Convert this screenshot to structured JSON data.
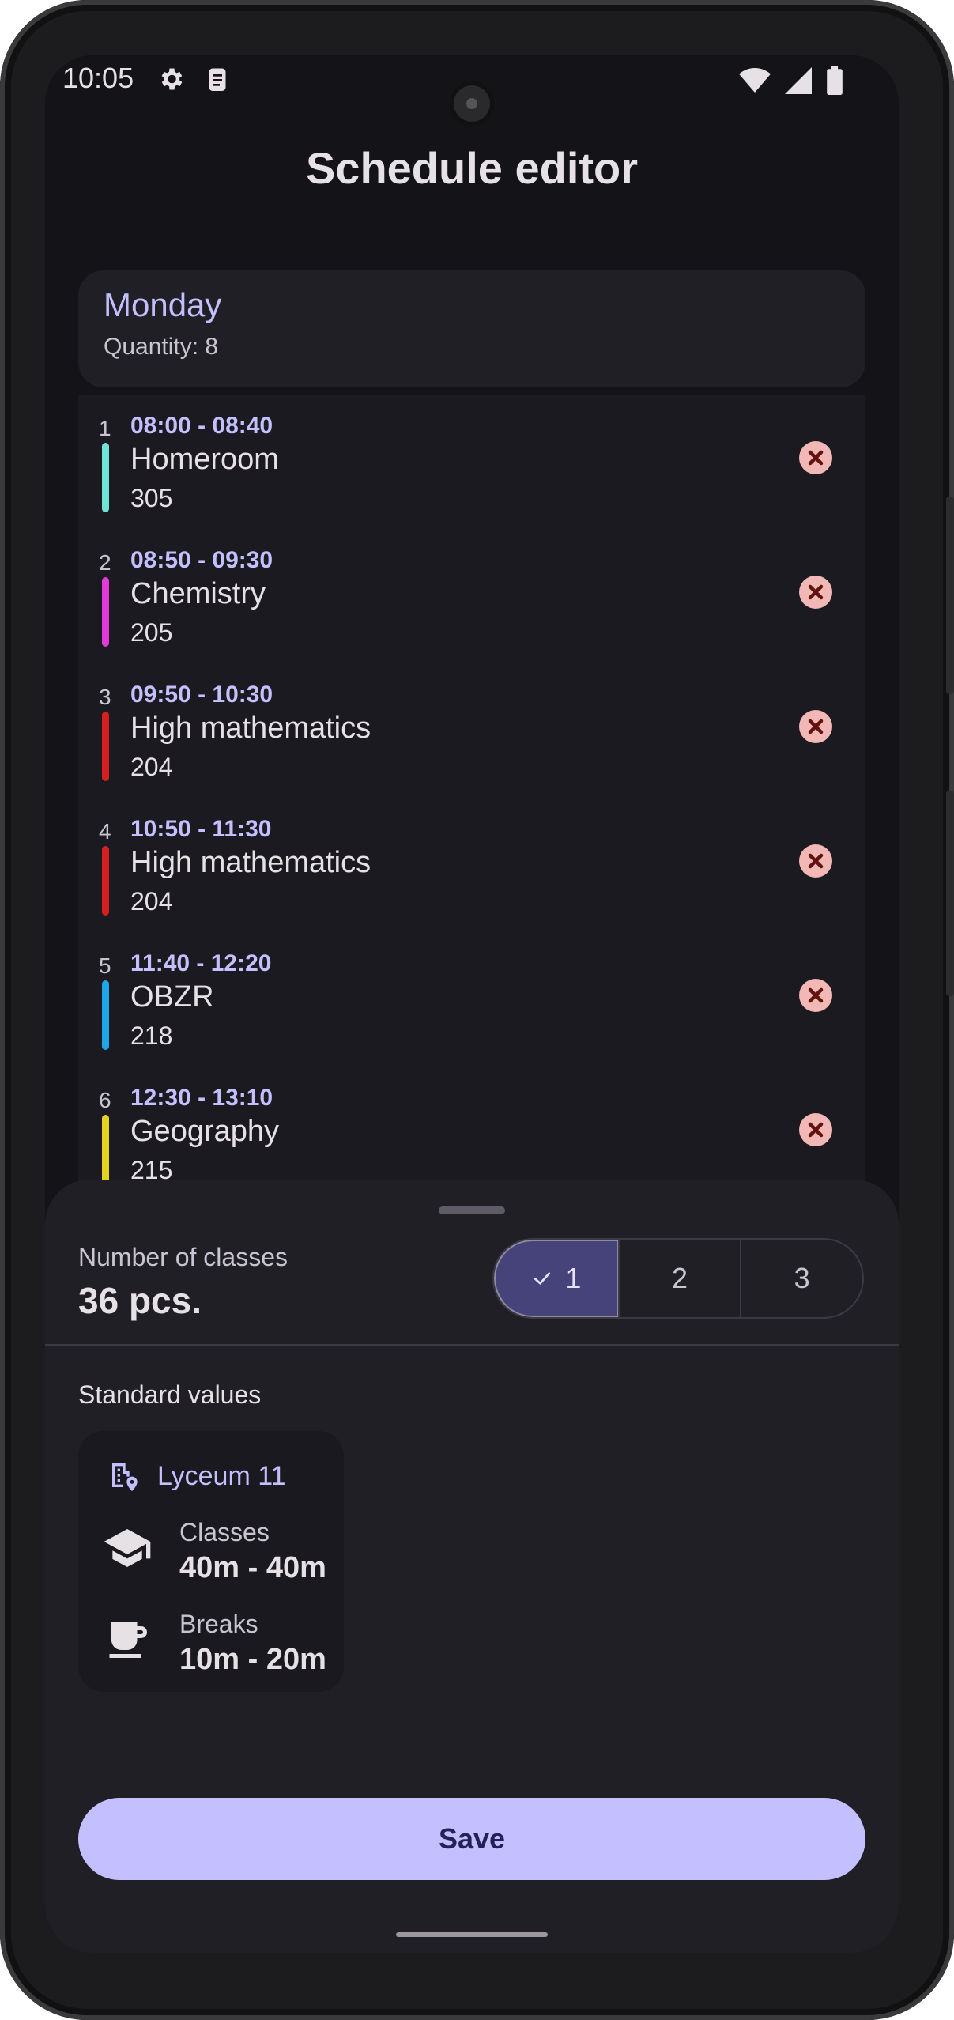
{
  "status_bar": {
    "time": "10:05"
  },
  "header": {
    "title": "Schedule editor"
  },
  "day": {
    "name": "Monday",
    "quantity": "Quantity: 8"
  },
  "lessons": [
    {
      "num": "1",
      "time": "08:00 - 08:40",
      "name": "Homeroom",
      "room": "305",
      "color": "#6fe3d6"
    },
    {
      "num": "2",
      "time": "08:50 - 09:30",
      "name": "Chemistry",
      "room": "205",
      "color": "#e23ad9"
    },
    {
      "num": "3",
      "time": "09:50 - 10:30",
      "name": "High mathematics",
      "room": "204",
      "color": "#d42020"
    },
    {
      "num": "4",
      "time": "10:50 - 11:30",
      "name": "High mathematics",
      "room": "204",
      "color": "#d42020"
    },
    {
      "num": "5",
      "time": "11:40 - 12:20",
      "name": "OBZR",
      "room": "218",
      "color": "#1fa6e8"
    },
    {
      "num": "6",
      "time": "12:30 - 13:10",
      "name": "Geography",
      "room": "215",
      "color": "#e3d21e"
    }
  ],
  "sheet": {
    "classes_label": "Number of classes",
    "classes_value": "36 pcs.",
    "segments": [
      "1",
      "2",
      "3"
    ],
    "selected_segment": "1",
    "standard_label": "Standard values",
    "standard": {
      "school": "Lyceum 11",
      "classes_label": "Classes",
      "classes_value": "40m - 40m",
      "breaks_label": "Breaks",
      "breaks_value": "10m - 20m"
    },
    "save_label": "Save"
  },
  "colors": {
    "accent": "#c4c0ff",
    "background": "#141318",
    "danger": "#f2b8b5"
  }
}
